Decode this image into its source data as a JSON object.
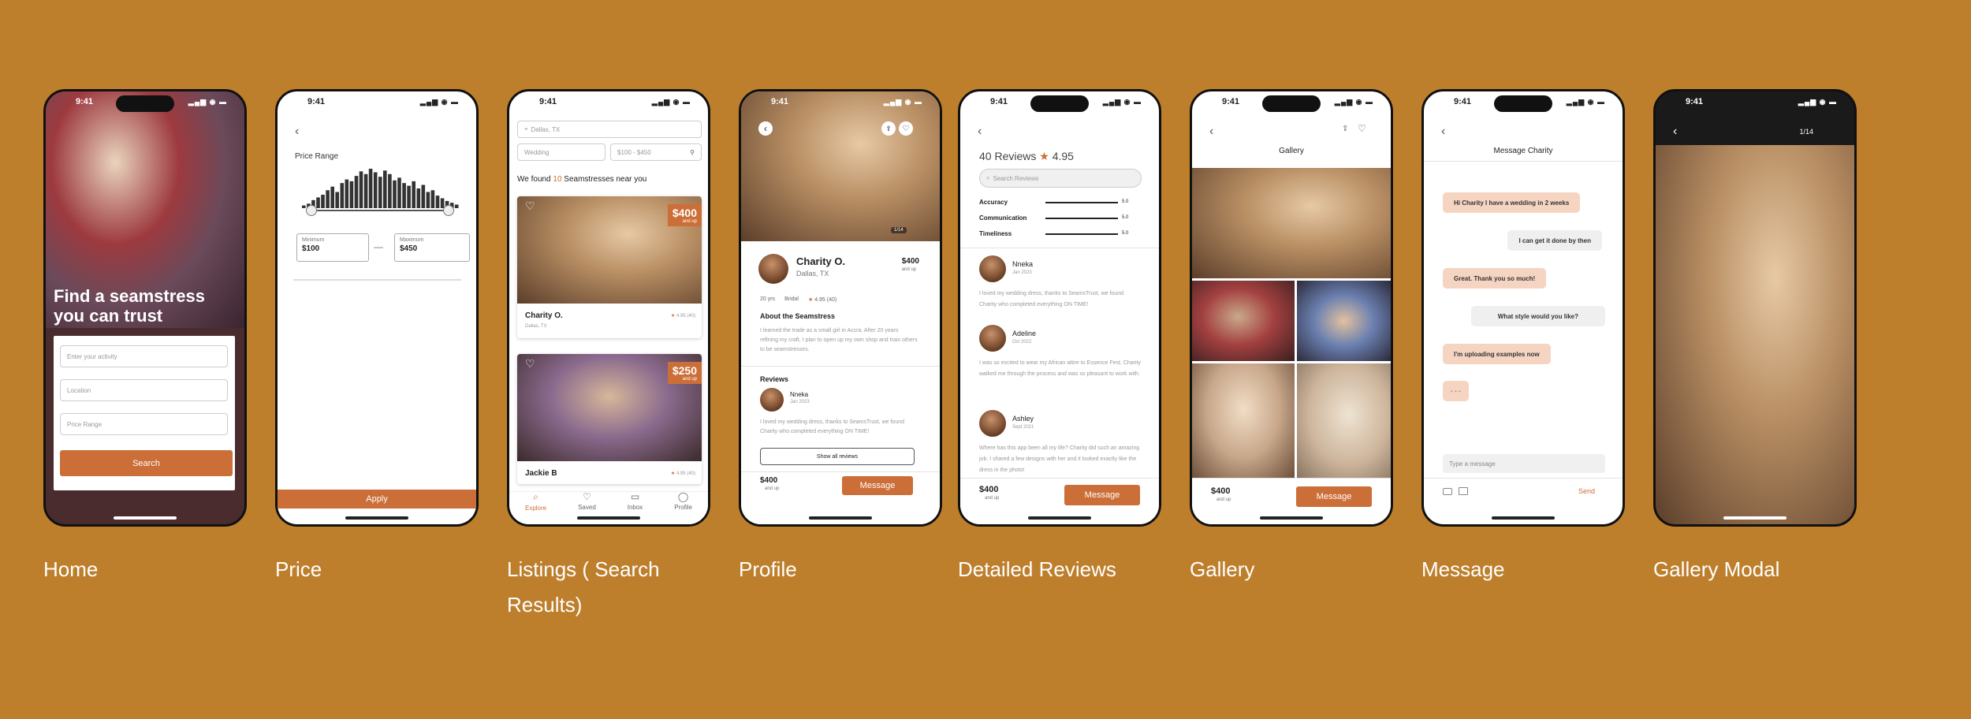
{
  "status_time": "9:41",
  "status_icons": "▂▄▆ ◉ ▬",
  "icons": {
    "back": "‹",
    "heart": "♡",
    "share": "⇪",
    "filter": "⚲",
    "pin": "⌖",
    "search": "⌕",
    "star": "★"
  },
  "colors": {
    "background": "#BE7F2C",
    "accent": "#CC6E38",
    "bubble_me": "#F5D5C2"
  },
  "captions": {
    "home": "Home",
    "price": "Price",
    "listings": "Listings ( Search Results)",
    "profile": "Profile",
    "reviews": "Detailed Reviews",
    "gallery": "Gallery",
    "message": "Message",
    "modal": "Gallery Modal"
  },
  "home": {
    "headline": "Find a seamstress you can trust",
    "activity_placeholder": "Enter your activity",
    "location_placeholder": "Location",
    "price_placeholder": "Price Range",
    "search_button": "Search"
  },
  "price": {
    "title": "Price Range",
    "histogram": [
      3,
      5,
      9,
      12,
      15,
      20,
      24,
      18,
      28,
      32,
      30,
      36,
      41,
      38,
      44,
      40,
      35,
      42,
      38,
      31,
      34,
      28,
      25,
      30,
      22,
      26,
      18,
      20,
      14,
      11,
      8,
      6,
      4
    ],
    "min_label": "Minimum",
    "min_value": "$100",
    "max_label": "Maximum",
    "max_value": "$450",
    "dash": "—",
    "apply_button": "Apply"
  },
  "listings": {
    "location": "Dallas, TX",
    "category": "Wedding",
    "price_filter": "$100 - $450",
    "found_prefix": "We found ",
    "found_count": "10",
    "found_suffix": " Seamstresses near you",
    "cards": [
      {
        "price": "$400",
        "and_up": "and up",
        "name": "Charity O.",
        "location": "Dallas, TX",
        "rating": "4.95 (40)"
      },
      {
        "price": "$250",
        "and_up": "and up",
        "name": "Jackie B",
        "location": "",
        "rating": "4.95 (40)"
      }
    ],
    "tabs": [
      "Explore",
      "Saved",
      "Inbox",
      "Profile"
    ],
    "tab_icons": [
      "⌕",
      "♡",
      "▭",
      "◯"
    ]
  },
  "profile": {
    "photo_counter": "1/14",
    "name": "Charity O.",
    "location": "Dallas, TX",
    "price": "$400",
    "and_up": "and up",
    "years": "20 yrs",
    "specialty": "Bridal",
    "rating": "4.95 (40)",
    "about_title": "About the Seamstress",
    "about_text": "I learned the trade as a small girl in Accra. After 20 years refining my craft, I plan to open up my own shop and train others to be seamstresses.",
    "reviews_title": "Reviews",
    "reviewer": "Nneka",
    "review_date": "Jan 2023",
    "review_text": "I loved my wedding dress, thanks to SeamsTrust, we found Charity who completed everything ON TIME!",
    "show_all": "Show all reviews",
    "message_button": "Message"
  },
  "reviews": {
    "count_label": "40 Reviews",
    "score": "4.95",
    "search_placeholder": "Search Reviews",
    "categories": [
      {
        "label": "Accuracy",
        "score": "5.0"
      },
      {
        "label": "Communication",
        "score": "5.0"
      },
      {
        "label": "Timeliness",
        "score": "5.0"
      }
    ],
    "items": [
      {
        "name": "Nneka",
        "date": "Jan 2023",
        "text": "I loved my wedding dress, thanks to SeamsTrust, we found Charity who completed everything ON TIME!"
      },
      {
        "name": "Adeline",
        "date": "Oct 2022",
        "text": "I was so excited to wear my African attire to Essence Fest. Charity walked me through the process and was so pleasant to work with."
      },
      {
        "name": "Ashley",
        "date": "Sept 2021",
        "text": "Where has this app been all my life? Charity did such an amazing job. I shared a few designs with her and it looked exactly like the dress in the photo!"
      }
    ],
    "price": "$400",
    "and_up": "and up",
    "message_button": "Message"
  },
  "gallery": {
    "title": "Gallery",
    "price": "$400",
    "and_up": "and up",
    "message_button": "Message"
  },
  "message": {
    "title": "Message Charity",
    "bubbles": [
      {
        "text": "Hi Charity I have a wedding in 2 weeks",
        "side": "me"
      },
      {
        "text": "I can get it done by then",
        "side": "them"
      },
      {
        "text": "Great. Thank you so much!",
        "side": "me"
      },
      {
        "text": "What style would you like?",
        "side": "them"
      },
      {
        "text": "I'm uploading examples now",
        "side": "me"
      },
      {
        "text": "• • •",
        "side": "me"
      }
    ],
    "input_placeholder": "Type a message",
    "send": "Send"
  },
  "modal": {
    "counter": "1/14"
  }
}
